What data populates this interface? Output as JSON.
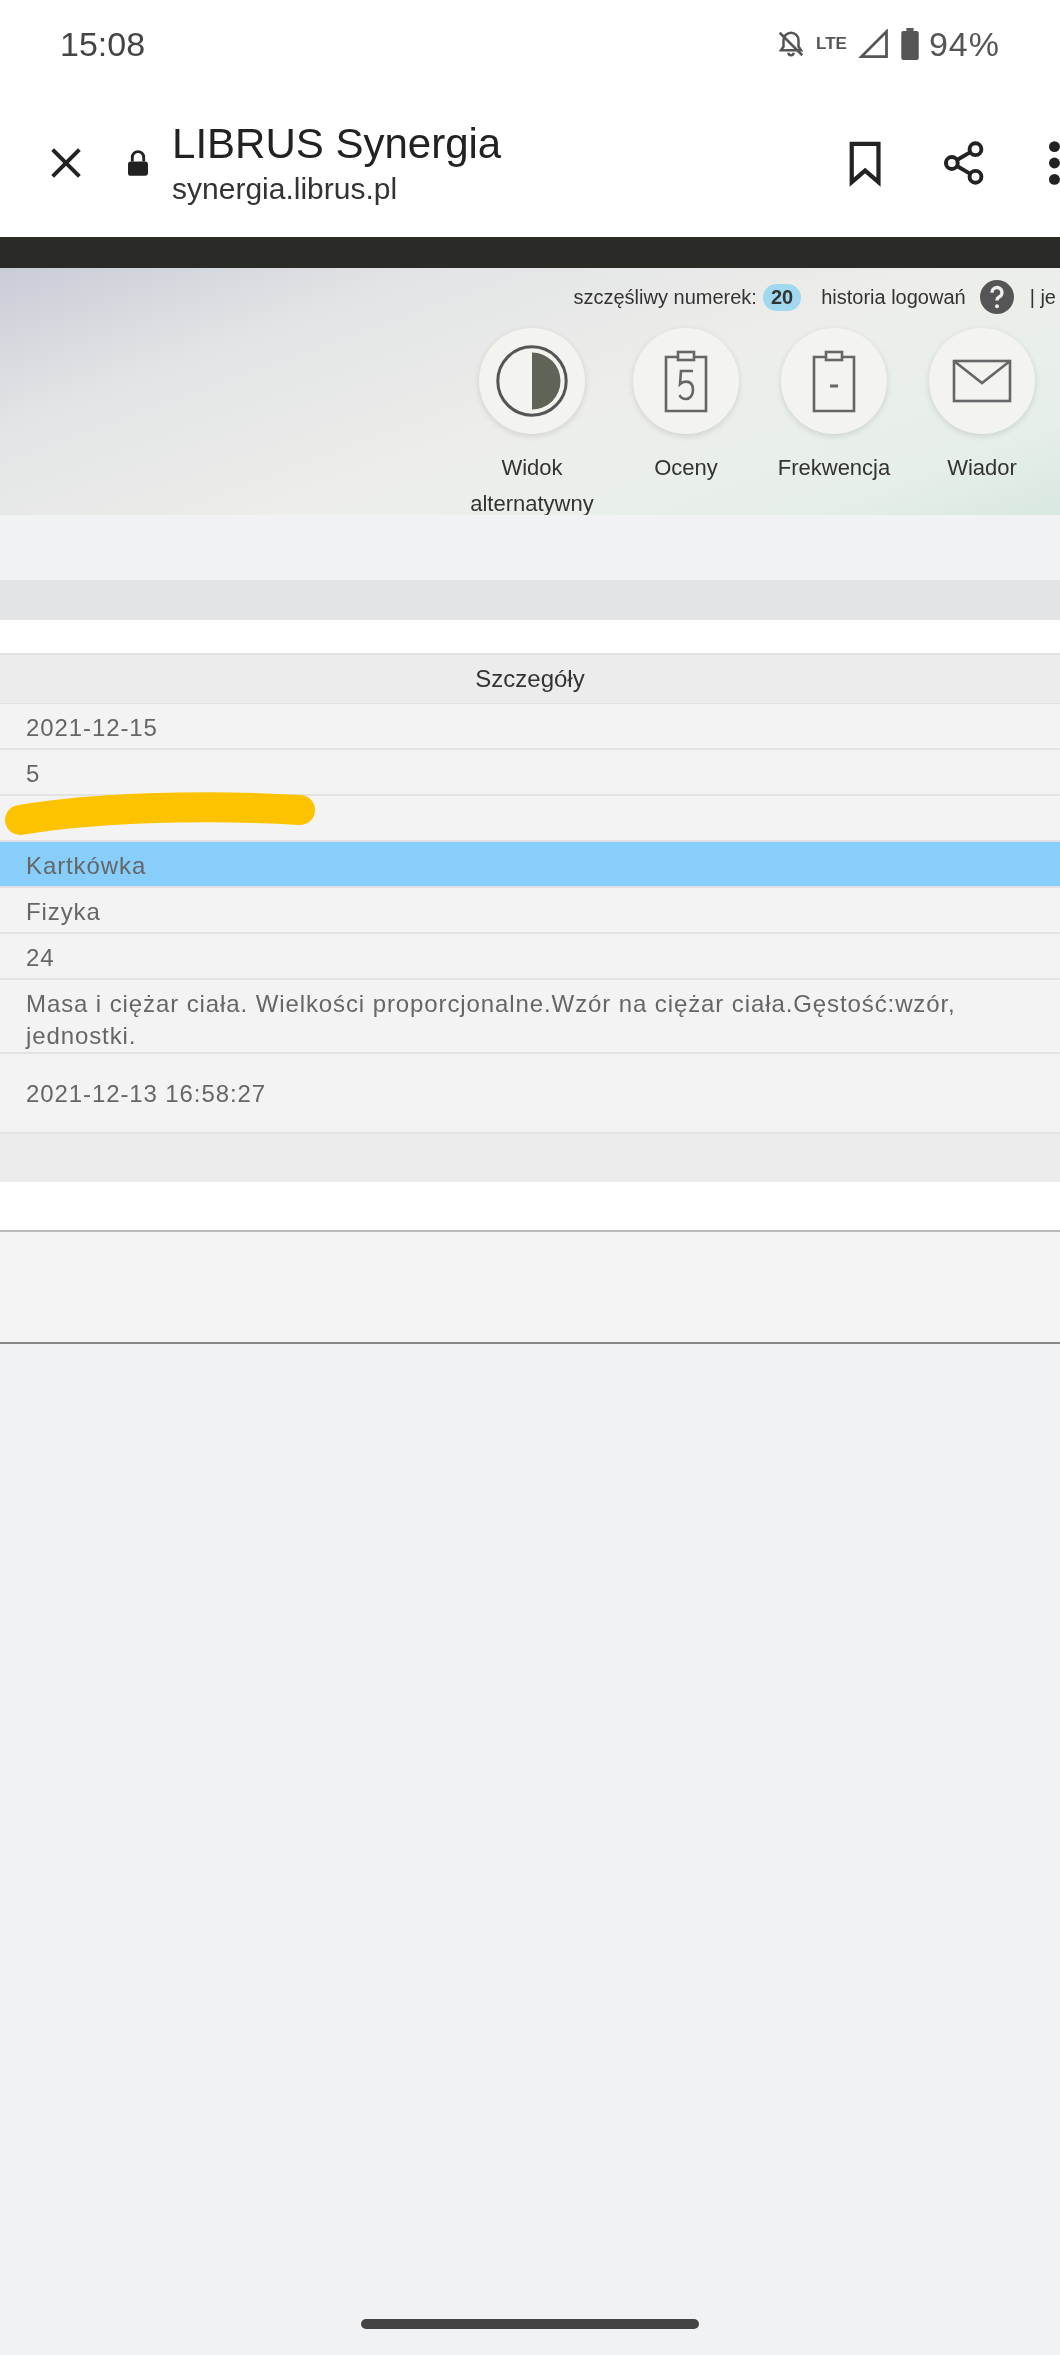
{
  "status_bar": {
    "time": "15:08",
    "network": "LTE",
    "battery": "94%"
  },
  "browser": {
    "title": "LIBRUS Synergia",
    "url": "synergia.librus.pl"
  },
  "header": {
    "lucky_number_label": "szczęśliwy numerek:",
    "lucky_number": "20",
    "login_history": "historia logowań",
    "cut_link": "| je",
    "nav": [
      {
        "label": "Widok alternatywny"
      },
      {
        "label": "Oceny"
      },
      {
        "label": "Frekwencja"
      },
      {
        "label": "Wiador"
      }
    ]
  },
  "table": {
    "heading": "Szczegóły",
    "rows": [
      {
        "text": "2021-12-15",
        "selected": false,
        "kind": "plain"
      },
      {
        "text": "5",
        "selected": false,
        "kind": "plain"
      },
      {
        "selected": false,
        "kind": "redacted"
      },
      {
        "text": "Kartkówka",
        "selected": true,
        "kind": "plain"
      },
      {
        "text": "Fizyka",
        "selected": false,
        "kind": "plain"
      },
      {
        "text": "24",
        "selected": false,
        "kind": "plain"
      },
      {
        "text": "Masa i ciężar ciała. Wielkości proporcjonalne.Wzór na ciężar ciała.Gęstość:wzór, jednostki.",
        "selected": false,
        "kind": "plain"
      },
      {
        "text": "2021-12-13 16:58:27",
        "selected": false,
        "kind": "tall"
      }
    ]
  }
}
